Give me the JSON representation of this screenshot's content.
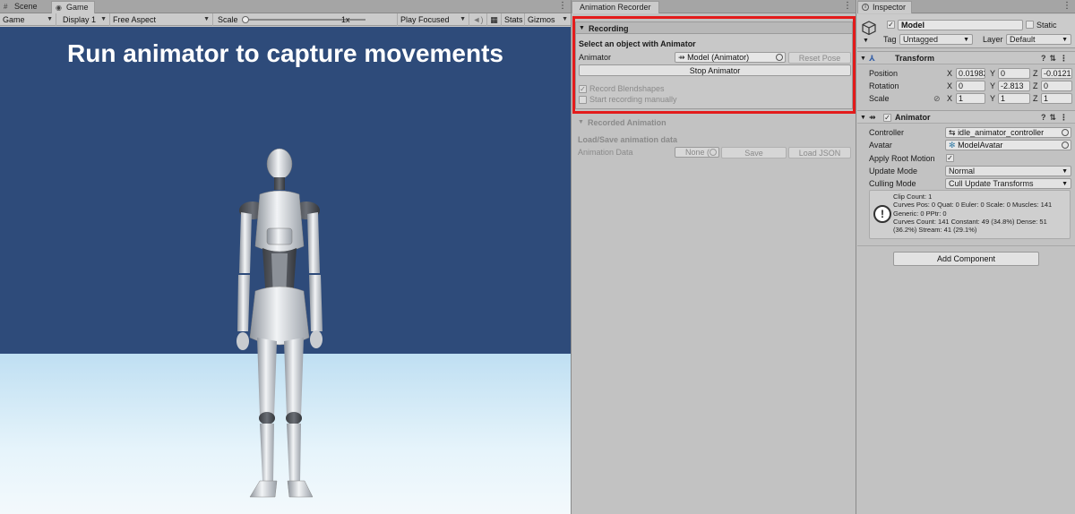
{
  "game_panel": {
    "tabs": [
      {
        "label": "Scene",
        "icon": "hash-icon"
      },
      {
        "label": "Game",
        "icon": "gamepad-icon"
      }
    ],
    "toolbar": {
      "mode": "Game",
      "display": "Display 1",
      "aspect": "Free Aspect",
      "scale_label": "Scale",
      "scale_value": "1x",
      "play_mode": "Play Focused",
      "stats": "Stats",
      "gizmos": "Gizmos"
    },
    "overlay_text": "Run animator to capture movements"
  },
  "recorder": {
    "tab": "Animation Recorder",
    "recording_header": "Recording",
    "select_prompt": "Select an object with Animator",
    "animator_label": "Animator",
    "animator_value": "Model (Animator)",
    "reset_pose": "Reset Pose",
    "stop_animator": "Stop Animator",
    "record_blendshapes": "Record Blendshapes",
    "start_recording_manually": "Start recording manually",
    "recorded_header": "Recorded Animation",
    "load_save_title": "Load/Save animation data",
    "animation_data_label": "Animation Data",
    "animation_data_value": "None (",
    "save": "Save",
    "load_json": "Load JSON"
  },
  "inspector": {
    "tab": "Inspector",
    "object_name": "Model",
    "static_label": "Static",
    "tag_label": "Tag",
    "tag_value": "Untagged",
    "layer_label": "Layer",
    "layer_value": "Default",
    "transform": {
      "title": "Transform",
      "position_label": "Position",
      "rotation_label": "Rotation",
      "scale_label": "Scale",
      "pos": {
        "x": "0.01982",
        "y": "0",
        "z": "-0.0121"
      },
      "rot": {
        "x": "0",
        "y": "-2.813",
        "z": "0"
      },
      "scl": {
        "x": "1",
        "y": "1",
        "z": "1"
      }
    },
    "animator": {
      "title": "Animator",
      "controller_label": "Controller",
      "controller_value": "idle_animator_controller",
      "avatar_label": "Avatar",
      "avatar_value": "ModelAvatar",
      "apply_root_motion_label": "Apply Root Motion",
      "update_mode_label": "Update Mode",
      "update_mode_value": "Normal",
      "culling_mode_label": "Culling Mode",
      "culling_mode_value": "Cull Update Transforms",
      "info_lines": [
        "Clip Count: 1",
        "Curves Pos: 0 Quat: 0 Euler: 0 Scale: 0 Muscles: 141",
        "Generic: 0 PPtr: 0",
        "Curves Count: 141 Constant: 49 (34.8%) Dense: 51",
        "(36.2%) Stream: 41 (29.1%)"
      ]
    },
    "add_component": "Add Component"
  },
  "axes": {
    "x": "X",
    "y": "Y",
    "z": "Z"
  },
  "colors": {
    "highlight": "#e31b1b",
    "sky": "#2e4b7a",
    "floor": "#d9eef8"
  }
}
